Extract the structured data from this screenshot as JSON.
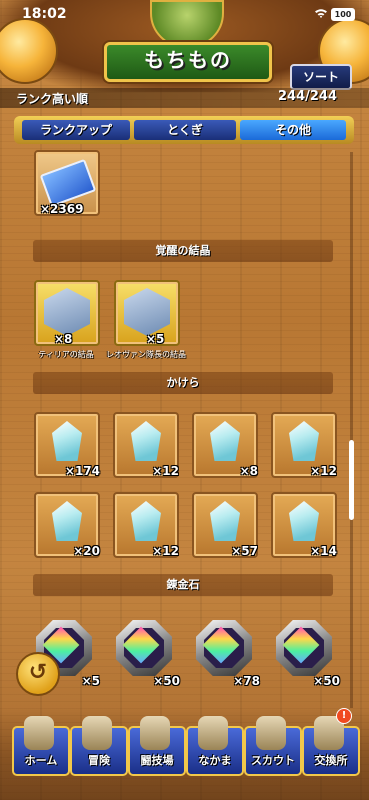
{
  "status_bar": {
    "time": "18:02",
    "battery": "100"
  },
  "header": {
    "title": "もちもの",
    "sort_label": "ソート"
  },
  "rank": {
    "label": "ランク高い順",
    "count": "244/244"
  },
  "tabs": [
    {
      "label": "ランクアップ",
      "selected": false
    },
    {
      "label": "とくぎ",
      "selected": false
    },
    {
      "label": "その他",
      "selected": true
    }
  ],
  "items": {
    "ticket": {
      "qty": "×2369"
    },
    "awakening": {
      "section_title": "覚醒の結晶",
      "list": [
        {
          "qty": "×8",
          "caption": "ティリアの結晶"
        },
        {
          "qty": "×5",
          "caption": "レオヴァン隊長の結晶"
        }
      ]
    },
    "fragments": {
      "section_title": "かけら",
      "list": [
        {
          "qty": "×174"
        },
        {
          "qty": "×12"
        },
        {
          "qty": "×8"
        },
        {
          "qty": "×12"
        },
        {
          "qty": "×20"
        },
        {
          "qty": "×12"
        },
        {
          "qty": "×57"
        },
        {
          "qty": "×14"
        }
      ]
    },
    "alchemy": {
      "section_title": "錬金石",
      "list": [
        {
          "qty": "×5"
        },
        {
          "qty": "×50"
        },
        {
          "qty": "×78"
        },
        {
          "qty": "×50"
        }
      ]
    }
  },
  "nav": [
    {
      "label": "ホーム",
      "icon": "home-icon"
    },
    {
      "label": "冒険",
      "icon": "adventure-icon"
    },
    {
      "label": "闘技場",
      "icon": "arena-icon"
    },
    {
      "label": "なかま",
      "icon": "party-icon"
    },
    {
      "label": "スカウト",
      "icon": "scout-icon"
    },
    {
      "label": "交換所",
      "icon": "exchange-icon",
      "badge": "!"
    }
  ],
  "colors": {
    "tab_selected": "#1b6ad8",
    "tab_normal": "#1a2f78",
    "frame_gold": "#f2c84a"
  }
}
